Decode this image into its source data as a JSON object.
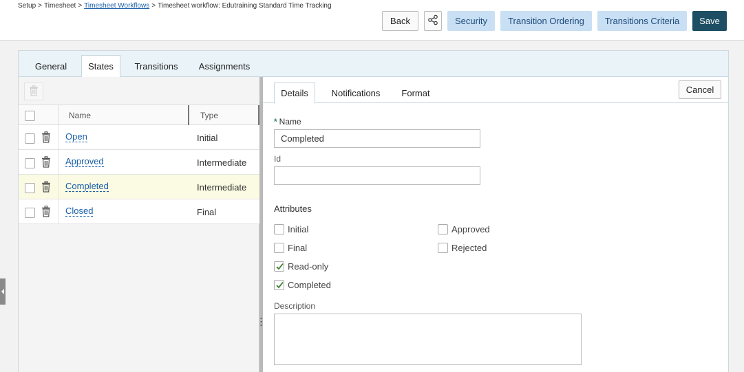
{
  "breadcrumb": {
    "items": [
      "Setup",
      "Timesheet",
      "Timesheet Workflows",
      "Timesheet workflow: Edutraining Standard Time Tracking"
    ],
    "separator": ">"
  },
  "header_buttons": {
    "back": "Back",
    "security": "Security",
    "transition_ordering": "Transition Ordering",
    "transitions_criteria": "Transitions Criteria",
    "save": "Save"
  },
  "main_tabs": [
    "General",
    "States",
    "Transitions",
    "Assignments"
  ],
  "active_main_tab": "States",
  "states_grid": {
    "columns": {
      "name": "Name",
      "type": "Type"
    },
    "rows": [
      {
        "name": "Open",
        "type": "Initial",
        "selected": false
      },
      {
        "name": "Approved",
        "type": "Intermediate",
        "selected": false
      },
      {
        "name": "Completed",
        "type": "Intermediate",
        "selected": true
      },
      {
        "name": "Closed",
        "type": "Final",
        "selected": false
      }
    ]
  },
  "detail_tabs": [
    "Details",
    "Notifications",
    "Format"
  ],
  "active_detail_tab": "Details",
  "cancel_label": "Cancel",
  "form": {
    "name_label": "Name",
    "name_required_marker": "*",
    "name_value": "Completed",
    "id_label": "Id",
    "id_value": "",
    "attributes_label": "Attributes",
    "attributes": {
      "initial": {
        "label": "Initial",
        "checked": false
      },
      "final": {
        "label": "Final",
        "checked": false
      },
      "read_only": {
        "label": "Read-only",
        "checked": true
      },
      "completed": {
        "label": "Completed",
        "checked": true
      },
      "approved": {
        "label": "Approved",
        "checked": false
      },
      "rejected": {
        "label": "Rejected",
        "checked": false
      }
    },
    "description_label": "Description",
    "description_value": ""
  },
  "colors": {
    "save_button": "#1d4e63",
    "light_button": "#c8dff4",
    "link": "#1a5fa8",
    "selected_row": "#fbfbe3",
    "required_marker": "#2e8b57",
    "checkmark": "#3a7d2c"
  },
  "icons": [
    "share-icon",
    "trash-icon",
    "checkmark-icon",
    "collapse-arrow-icon",
    "splitter-grip-icon"
  ]
}
